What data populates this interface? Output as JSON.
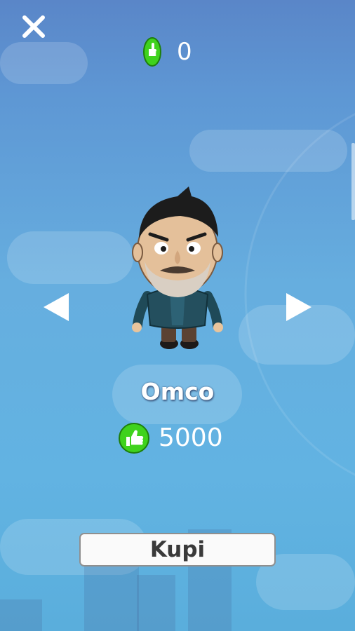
{
  "header": {
    "close_icon": "close-icon",
    "coin_icon": "thumbs-up-coin-icon",
    "coin_count": "0"
  },
  "shop": {
    "prev_icon": "arrow-left-icon",
    "next_icon": "arrow-right-icon",
    "character_name": "Omco",
    "price_icon": "thumbs-up-coin-icon",
    "price": "5000",
    "buy_label": "Kupi"
  },
  "colors": {
    "sky_top": "#5a86c8",
    "sky_bottom": "#62b3e2",
    "coin_green": "#3fd21d",
    "button_bg": "#fafafa",
    "button_text": "#3a3a3a"
  }
}
